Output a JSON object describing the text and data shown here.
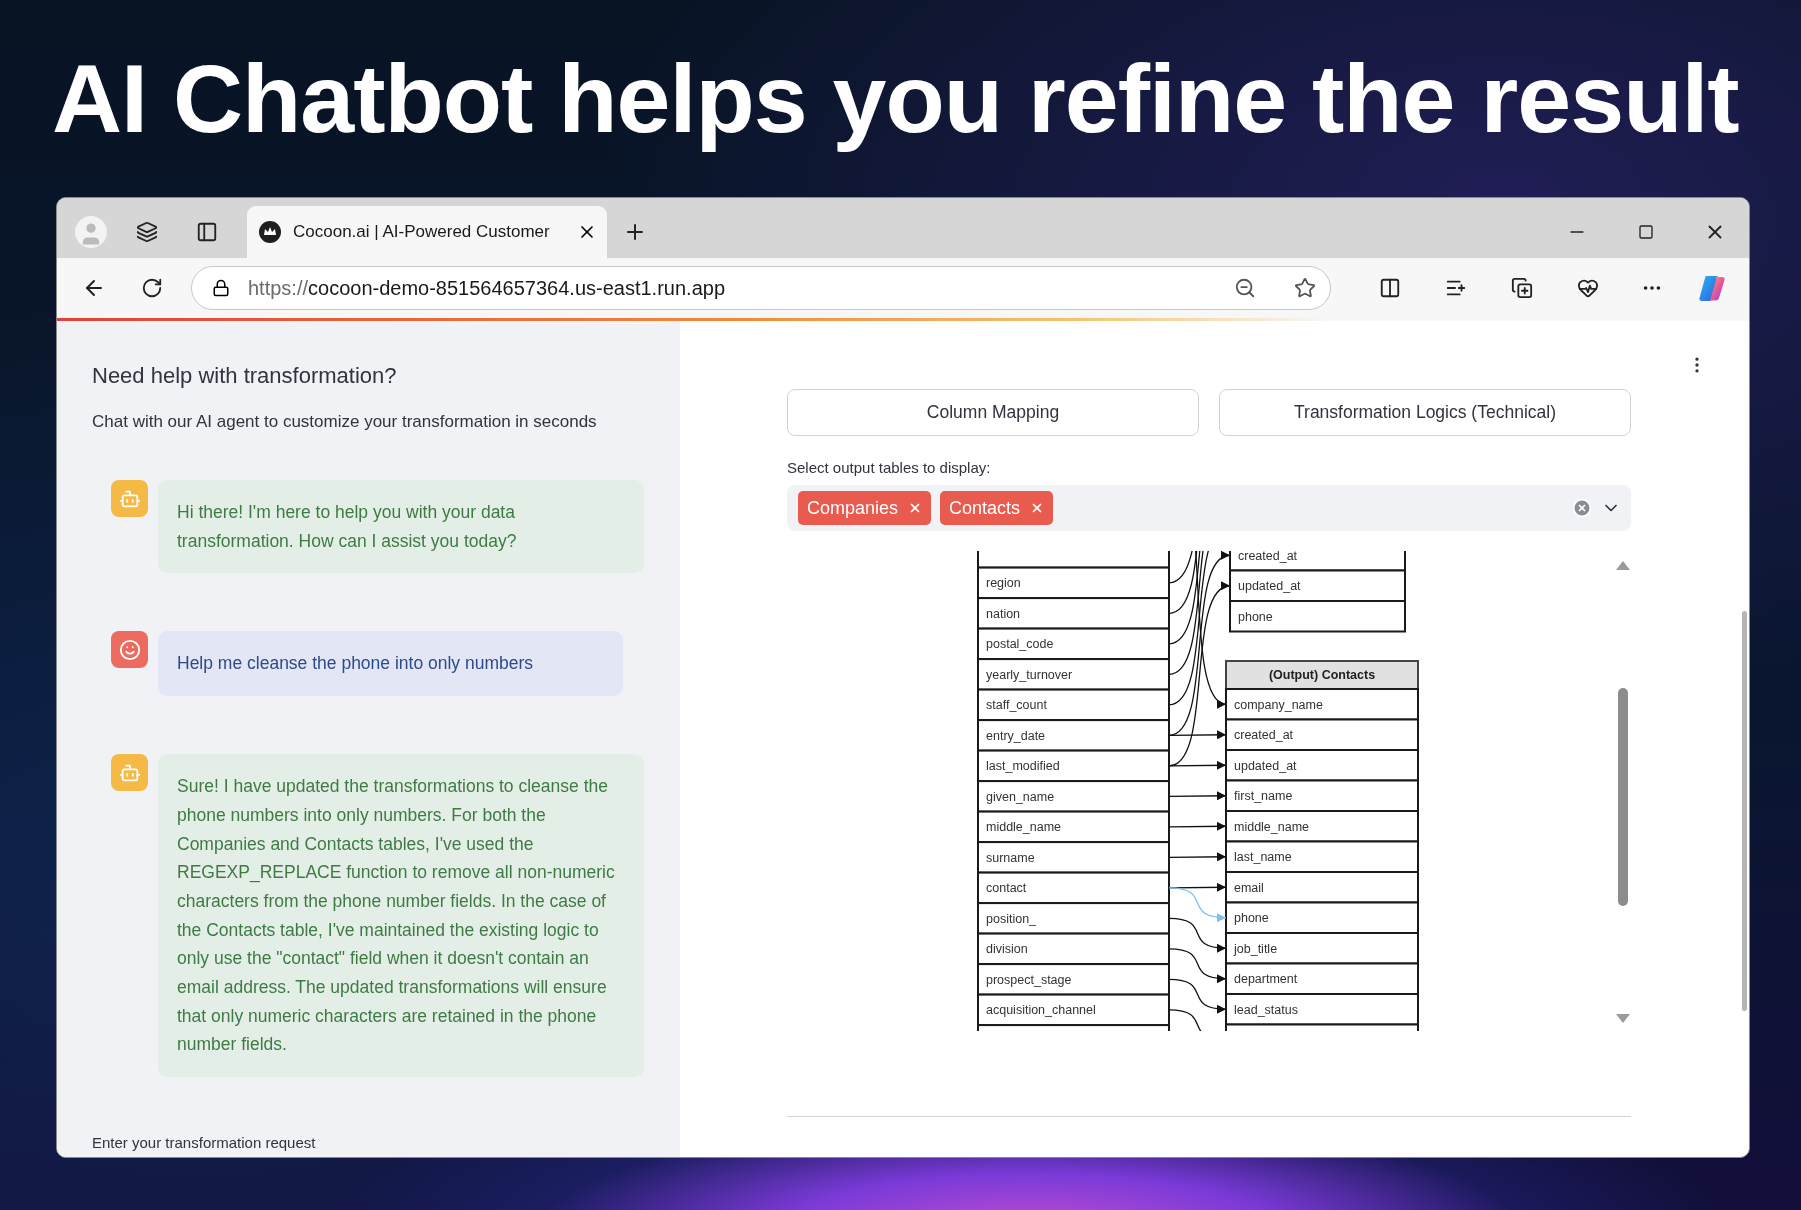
{
  "headline": "AI Chatbot helps you refine the result",
  "browser": {
    "tab_title": "Cocoon.ai | AI-Powered Customer",
    "url_scheme": "https://",
    "url_host": "cocoon-demo-851564657364.us-east1.run.app"
  },
  "chat": {
    "title": "Need help with transformation?",
    "subtitle": "Chat with our AI agent to customize your transformation in seconds",
    "messages": [
      {
        "kind": "bot",
        "text": "Hi there! I'm here to help you with your data transformation. How can I assist you today?"
      },
      {
        "kind": "user",
        "text": "Help me cleanse the phone into only numbers"
      },
      {
        "kind": "bot",
        "text": "Sure! I have updated the transformations to cleanse the phone numbers into only numbers. For both the Companies and Contacts tables, I've used the REGEXP_REPLACE function to remove all non-numeric characters from the phone number fields. In the case of the Contacts table, I've maintained the existing logic to only use the \"contact\" field when it doesn't contain an email address. The updated transformations will ensure that only numeric characters are retained in the phone number fields."
      }
    ],
    "input_label": "Enter your transformation request"
  },
  "view_buttons": [
    "Column Mapping",
    "Transformation Logics (Technical)"
  ],
  "table_select": {
    "label": "Select output tables to display:",
    "tags": [
      "Companies",
      "Contacts"
    ]
  },
  "diagram": {
    "source_fields": [
      "region",
      "nation",
      "postal_code",
      "yearly_turnover",
      "staff_count",
      "entry_date",
      "last_modified",
      "given_name",
      "middle_name",
      "surname",
      "contact",
      "position_",
      "division",
      "prospect_stage",
      "acquisition_channel"
    ],
    "companies_fields": [
      "created_at",
      "updated_at",
      "phone"
    ],
    "contacts_title": "(Output) Contacts",
    "contacts_fields": [
      "company_name",
      "created_at",
      "updated_at",
      "first_name",
      "middle_name",
      "last_name",
      "email",
      "phone",
      "job_title",
      "department",
      "lead_status"
    ]
  }
}
